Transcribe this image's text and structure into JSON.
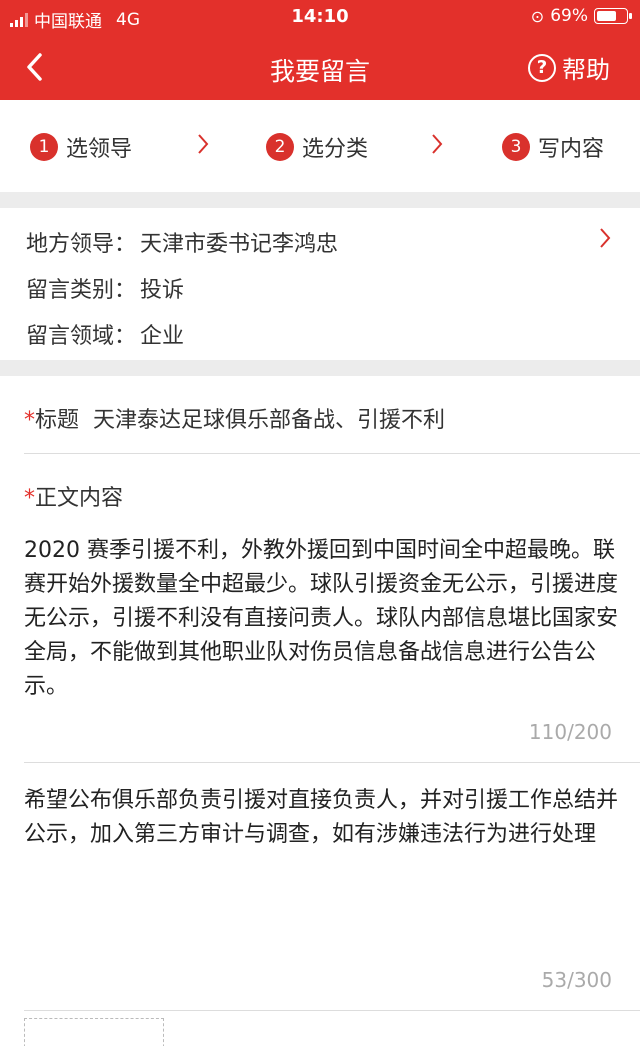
{
  "status": {
    "carrier": "中国联通",
    "network": "4G",
    "time": "14:10",
    "battery": "69%",
    "battery_level": 0.69
  },
  "nav": {
    "title": "我要留言",
    "help_label": "帮助",
    "help_symbol": "?"
  },
  "steps": [
    {
      "num": "1",
      "label": "选领导"
    },
    {
      "num": "2",
      "label": "选分类"
    },
    {
      "num": "3",
      "label": "写内容"
    }
  ],
  "info": {
    "leader_label": "地方领导：",
    "leader_value": "天津市委书记李鸿忠",
    "category_label": "留言类别：",
    "category_value": "投诉",
    "domain_label": "留言领域：",
    "domain_value": "企业"
  },
  "form": {
    "title_label": "标题",
    "title_value": "天津泰达足球俱乐部备战、引援不利",
    "body_label": "正文内容",
    "body_text": "2020 赛季引援不利，外教外援回到中国时间全中超最晚。联赛开始外援数量全中超最少。球队引援资金无公示，引援进度无公示，引援不利没有直接问责人。球队内部信息堪比国家安全局，不能做到其他职业队对伤员信息备战信息进行公告公示。",
    "body_counter": "110/200",
    "hope_text": "希望公布俱乐部负责引援对直接负责人，并对引援工作总结并公示，加入第三方审计与调查，如有涉嫌违法行为进行处理",
    "hope_counter": "53/300"
  },
  "colors": {
    "brand_red": "#e3302b"
  }
}
